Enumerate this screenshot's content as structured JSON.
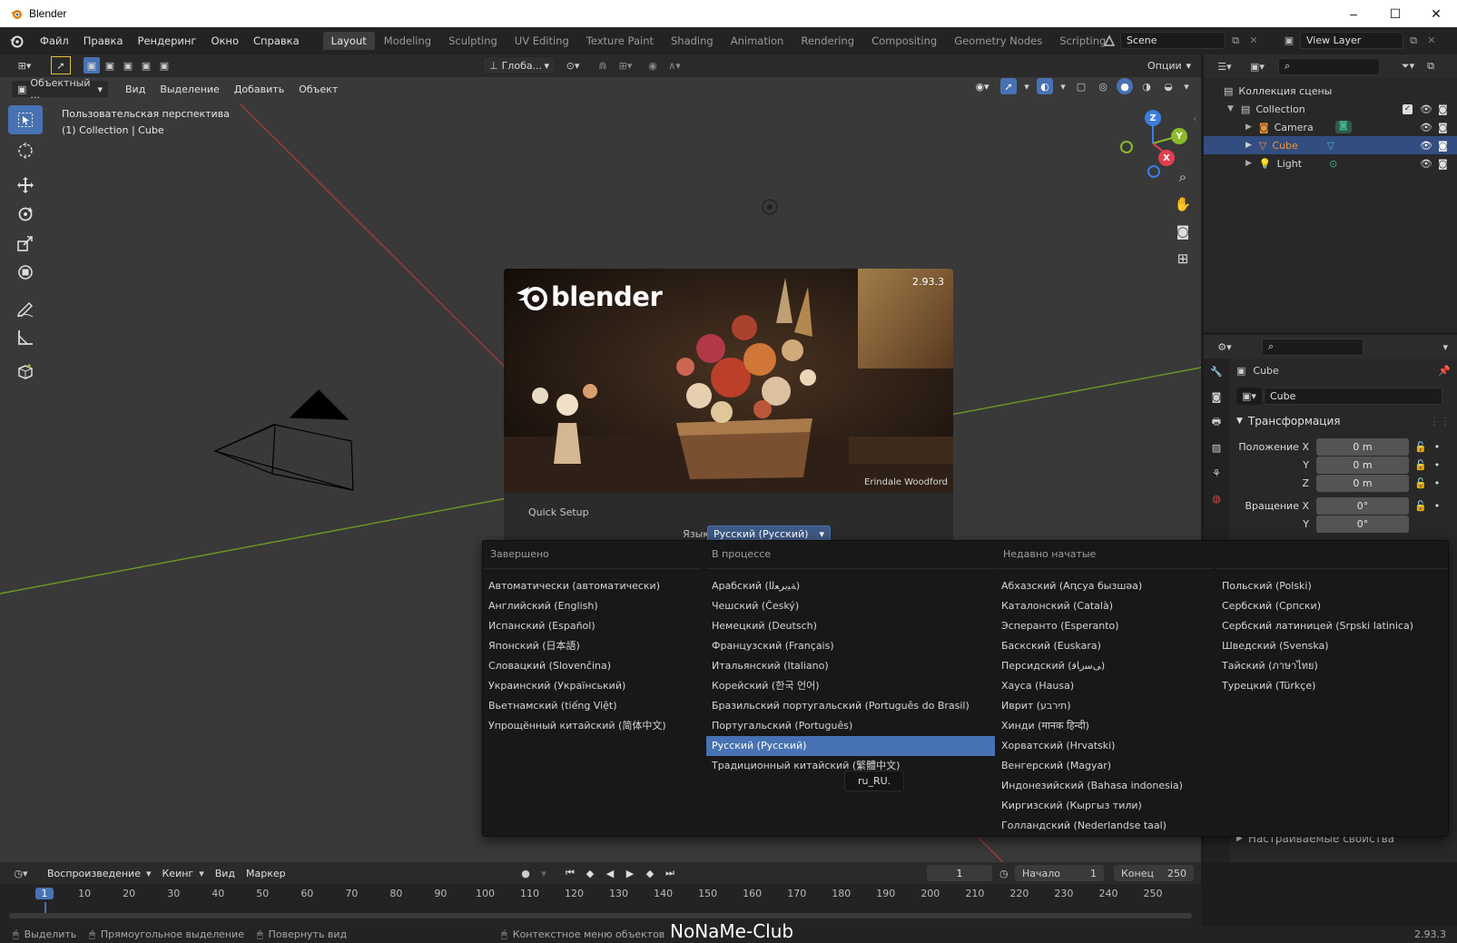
{
  "window": {
    "title": "Blender",
    "controls": {
      "minimize": "–",
      "maximize": "☐",
      "close": "✕"
    }
  },
  "menu": [
    "Файл",
    "Правка",
    "Рендеринг",
    "Окно",
    "Справка"
  ],
  "workspaces": [
    "Layout",
    "Modeling",
    "Sculpting",
    "UV Editing",
    "Texture Paint",
    "Shading",
    "Animation",
    "Rendering",
    "Compositing",
    "Geometry Nodes",
    "Scripting"
  ],
  "add_tab": "+",
  "scene": {
    "label": "Scene",
    "view_layer": "View Layer"
  },
  "toolbar": {
    "transform_orientation": "Глоба...",
    "options": "Опции"
  },
  "viewport_header": {
    "mode": "Объектный ...",
    "items": [
      "Вид",
      "Выделение",
      "Добавить",
      "Объект"
    ]
  },
  "viewport": {
    "overlay_title": "Пользовательская перспектива",
    "overlay_sub": "(1) Collection | Cube",
    "gizmo": {
      "x": "X",
      "y": "Y",
      "z": "Z"
    }
  },
  "splash": {
    "version": "2.93.3",
    "logo_text": "blender",
    "credit": "Erindale Woodford",
    "quick_setup": "Quick Setup",
    "lang_label": "Язык",
    "lang_value": "Русский (Русский)",
    "tooltip": "ru_RU."
  },
  "languages": {
    "col1_header": "Завершено",
    "col1": [
      "Автоматически (автоматически)",
      "Английский (English)",
      "Испанский (Español)",
      "Японский (日本語)",
      "Словацкий (Slovenčina)",
      "Украинский (Український)",
      "Вьетнамский (tiếng Việt)",
      "Упрощённый китайский (简体中文)"
    ],
    "col2_header": "В процессе",
    "col2": [
      "Арабский (ﺔﻴﺑﺮﻌﻟﺍ)",
      "Чешский (Český)",
      "Немецкий (Deutsch)",
      "Французский (Français)",
      "Итальянский (Italiano)",
      "Корейский (한국 언어)",
      "Бразильский португальский (Português do Brasil)",
      "Португальский (Português)",
      "Русский (Русский)",
      "Традиционный китайский (繁體中文)"
    ],
    "selected": "Русский (Русский)",
    "col3_header": "Недавно начатые",
    "col3": [
      "Абхазский (Аԥсуа бызшәа)",
      "Каталонский (Català)",
      "Эсперанто (Esperanto)",
      "Баскский (Euskara)",
      "Персидский (ﯽﺳﺭﺎﻓ)",
      "Хауса (Hausa)",
      "Иврит (תירבע)",
      "Хинди (मानक हिन्दी)",
      "Хорватский (Hrvatski)",
      "Венгерский (Magyar)",
      "Индонезийский (Bahasa indonesia)",
      "Киргизский (Кыргыз тили)",
      "Голландский (Nederlandse taal)"
    ],
    "col4": [
      "Польский (Polski)",
      "Сербский (Српски)",
      "Сербский латиницей (Srpski latinica)",
      "Шведский (Svenska)",
      "Тайский (ภาษาไทย)",
      "Турецкий (Türkçe)"
    ]
  },
  "outliner": {
    "root": "Коллекция сцены",
    "collection": "Collection",
    "items": [
      "Camera",
      "Cube",
      "Light"
    ]
  },
  "properties": {
    "object_name": "Cube",
    "object_field": "Cube",
    "section": "Трансформация",
    "loc_label": "Положение X",
    "rot_label": "Вращение X",
    "axis_y": "Y",
    "axis_z": "Z",
    "loc_x": "0 m",
    "loc_y": "0 m",
    "loc_z": "0 m",
    "rot_x": "0°",
    "rot_y": "0°",
    "custom_props": "Настраиваемые свойства"
  },
  "timeline": {
    "items": [
      "Воспроизведение",
      "Кеинг",
      "Вид",
      "Маркер"
    ],
    "frame": "1",
    "start_label": "Начало",
    "start": "1",
    "end_label": "Конец",
    "end": "250",
    "ticks": [
      "1",
      "10",
      "20",
      "30",
      "40",
      "50",
      "60",
      "70",
      "80",
      "90",
      "100",
      "110",
      "120",
      "130",
      "140",
      "150",
      "160",
      "170",
      "180",
      "190",
      "200",
      "210",
      "220",
      "230",
      "240",
      "250"
    ]
  },
  "status": {
    "select": "Выделить",
    "box_select": "Прямоугольное выделение",
    "rotate": "Повернуть вид",
    "context": "Контекстное меню объектов",
    "watermark": "NoNaMe-Club",
    "version": "2.93.3"
  },
  "colors": {
    "accent": "#4772b3",
    "axis_x": "#e0404e",
    "axis_y": "#8cba2c",
    "axis_z": "#3c7ee0",
    "camera_orange": "#e59137",
    "cube_orange": "#f0943b"
  }
}
